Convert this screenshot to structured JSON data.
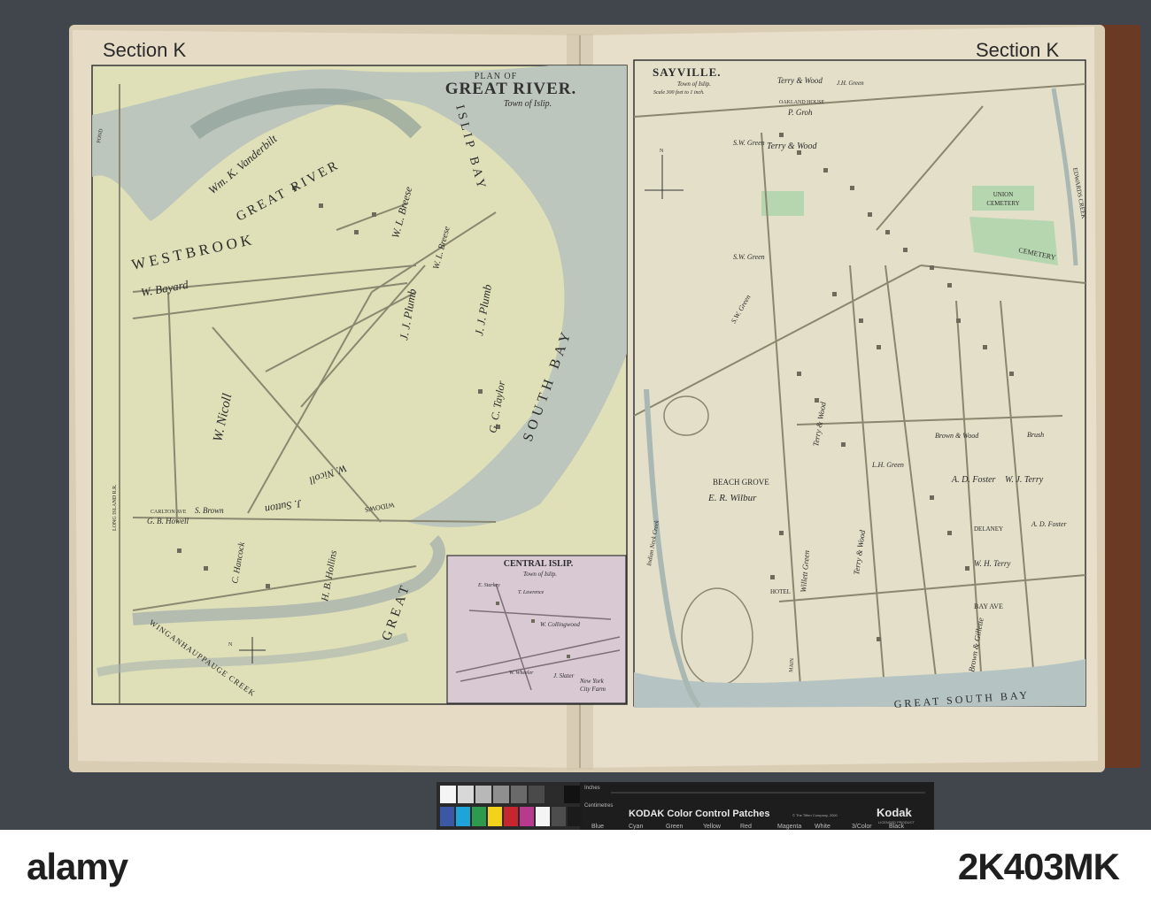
{
  "section_label_left": "Section K",
  "section_label_right": "Section K",
  "great_river": {
    "title_line1": "PLAN OF",
    "title_line2": "GREAT RIVER.",
    "subtitle": "Town of Islip.",
    "labels": {
      "westbrook": "WESTBROOK",
      "great_river": "GREAT RIVER",
      "south_bay": "SOUTH BAY",
      "great": "GREAT",
      "islip_bay": "ISLIP BAY",
      "vanderbilt": "Wm. K. Vanderbilt",
      "bayard": "W. Bayard",
      "nicoll": "W. Nicoll",
      "plumb1": "J. J. Plumb",
      "plumb2": "J. J. Plumb",
      "breese1": "W. L. Breese",
      "breese2": "W. L. Breese",
      "taylor": "G. C. Taylor",
      "nicoll2": "W. Nicoll",
      "sutton": "J. Sutton",
      "widows": "WIDOWS",
      "winganhauppauge": "WINGANHAUPPAUGE CREEK",
      "hollins": "H. B. Hollins",
      "hancock": "C. Hancock",
      "howell": "G. B. Howell",
      "brown": "S. Brown",
      "carlton": "CARLTON AVE",
      "pond": "POND",
      "long_island_rr": "LONG ISLAND R.R."
    }
  },
  "central_islip": {
    "title": "CENTRAL ISLIP.",
    "subtitle": "Town of Islip.",
    "labels": {
      "collingwood": "W. Collingwood",
      "slater": "J. Slater",
      "city_farm_1": "New York",
      "city_farm_2": "City Farm",
      "starkey": "E. Starkey",
      "lawrence": "T. Lawrence",
      "wheeler": "W. Wheeler"
    }
  },
  "sayville": {
    "title": "SAYVILLE.",
    "subtitle": "Town of Islip.",
    "scale": "Scale 300 feet to 1 inch.",
    "labels": {
      "terry_wood_top": "Terry & Wood",
      "green_top": "J.H. Green",
      "oakland_house": "OAKLAND HOUSE",
      "groh": "P. Groh",
      "union_cemetery_1": "UNION",
      "union_cemetery_2": "CEMETERY",
      "cemetery": "CEMETERY",
      "sw_green1": "S.W. Green",
      "sw_green2": "S.W. Green",
      "sw_green3": "S.W. Green",
      "terry_wood1": "Terry & Wood",
      "beach_grove": "BEACH GROVE",
      "wilbur": "E. R. Wilbur",
      "brown_wood": "Brown & Wood",
      "w_terry": "W. J. Terry",
      "ad_foster1": "A. D. Foster",
      "ad_foster2": "A. D. Foster",
      "delaney": "DELANEY",
      "wh_terry": "W. H. Terry",
      "hotel": "HOTEL",
      "great_south_bay": "GREAT  SOUTH  BAY",
      "brown_gillette": "Brown & Gillette",
      "terry_wood2": "Terry & Wood",
      "willett_green": "Willett Green",
      "terry_wood3": "Terry & Wood",
      "bay_ave": "BAY  AVE",
      "brush": "Brush",
      "edwards_creek": "EDWARDS CREEK",
      "indian_creek": "Indian  Neck  Creek",
      "main": "MAIN",
      "lh_green": "L.H. Green"
    }
  },
  "compass_left": "N",
  "compass_right": "N",
  "color_strip": {
    "title": "KODAK Color Control Patches",
    "brand": "Kodak",
    "copyright": "© The Tiffen Company, 2000",
    "licensed": "LICENSED PRODUCT",
    "row_inches": "Inches",
    "row_cm": "Centimetres",
    "patch_names": [
      "Blue",
      "Cyan",
      "Green",
      "Yellow",
      "Red",
      "Magenta",
      "White",
      "3/Color",
      "Black"
    ],
    "patch_colors": [
      "#3a58a6",
      "#1fa4d9",
      "#2e9a4e",
      "#f2d21a",
      "#c8262e",
      "#b83a8f",
      "#f4f4f4",
      "#4d4d4d",
      "#1b1b1b"
    ],
    "gray_colors": [
      "#f5f5f5",
      "#d8d8d8",
      "#b8b8b8",
      "#8f8f8f",
      "#6a6a6a",
      "#4a4a4a",
      "#2b2b2b",
      "#121212"
    ]
  },
  "watermark": {
    "logo": "alamy",
    "image_id": "2K403MK"
  }
}
